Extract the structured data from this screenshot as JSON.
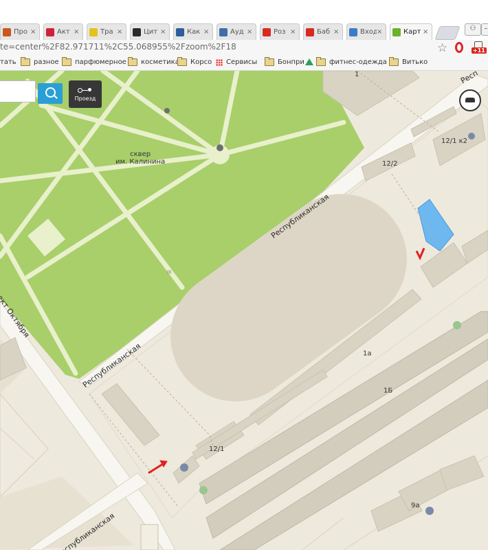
{
  "tabs": [
    {
      "label": "Про",
      "icon": "squirrel-icon",
      "color": "#c8571e"
    },
    {
      "label": "Акт",
      "icon": "k-logo-icon",
      "color": "#d0213b"
    },
    {
      "label": "Тра",
      "icon": "smiley-icon",
      "color": "#e5c21b"
    },
    {
      "label": "Цит",
      "icon": "b-logo-icon",
      "color": "#2b2b2b"
    },
    {
      "label": "Как",
      "icon": "globe-icon",
      "color": "#2d5d9c"
    },
    {
      "label": "Ауд",
      "icon": "pause-icon",
      "color": "#3d6fa8"
    },
    {
      "label": "Роз",
      "icon": "youtube-icon",
      "color": "#d72b22"
    },
    {
      "label": "Баб",
      "icon": "youtube-icon",
      "color": "#d72b22"
    },
    {
      "label": "Вход",
      "icon": "mail-bird-icon",
      "color": "#3b7dc4"
    },
    {
      "label": "Карт",
      "icon": "2gis-icon",
      "color": "#68b22d"
    }
  ],
  "address": {
    "url": "te=center%2F82.971711%2C55.068955%2Fzoom%2F18",
    "ext_badge": "+11"
  },
  "bookmarks": [
    {
      "label": "тать",
      "icon": "none"
    },
    {
      "label": "разное",
      "icon": "folder-icon"
    },
    {
      "label": "парфюмерное",
      "icon": "folder-icon"
    },
    {
      "label": "косметика",
      "icon": "folder-icon"
    },
    {
      "label": "Корсо",
      "icon": "folder-icon"
    },
    {
      "label": "Сервисы",
      "icon": "apps-grid-icon"
    },
    {
      "label": "Бонпри",
      "icon": "folder-icon"
    },
    {
      "label": "",
      "icon": "drive-icon"
    },
    {
      "label": "фитнес-одежда",
      "icon": "folder-icon"
    },
    {
      "label": "Витько",
      "icon": "folder-icon"
    }
  ],
  "map": {
    "route_button_label": "Проезд",
    "park_name_line1": "сквер",
    "park_name_line2": "им. Калинина",
    "streets": {
      "respublikanskaya": "Республиканская",
      "prospekt": "пект Октября",
      "repub_cut": "Респ"
    },
    "buildings": {
      "b1": "1",
      "b12_1k2": "12/1 к2",
      "b12_2": "12/2",
      "b1a": "1а",
      "b1b": "1Б",
      "b12_1": "12/1",
      "b9a": "9а",
      "door_marks": "III"
    },
    "colors": {
      "park": "#a8cf6a",
      "paths": "#e9f0cc",
      "ground": "#eee9dd",
      "building": "#d9d3c4",
      "stadium": "#ddd6c6",
      "water": "#6db8f0",
      "annotation": "#e02020"
    }
  }
}
